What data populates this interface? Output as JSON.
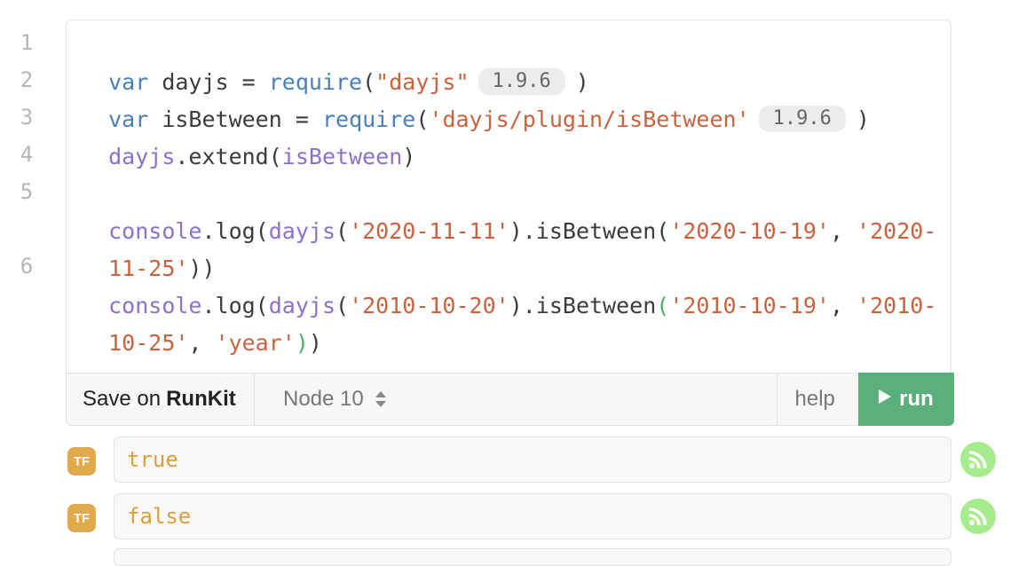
{
  "editor": {
    "line_numbers": [
      "1",
      "2",
      "3",
      "4",
      "5",
      "6"
    ],
    "lines": [
      {
        "kw": "var",
        "name": " dayjs ",
        "eq": "=",
        "fn": "require",
        "open": "(",
        "str": "\"dayjs\"",
        "version": "1.9.6",
        "close": ")"
      },
      {
        "kw": "var",
        "name": " isBetween ",
        "eq": "=",
        "fn": "require",
        "open": "(",
        "str": "'dayjs/plugin/isBetween'",
        "version": "1.9.6",
        "close": ")"
      },
      {
        "obj": "dayjs",
        "method": ".extend(",
        "arg": "isBetween",
        "close": ")"
      },
      {
        "obj": "console",
        "method": ".log(",
        "fn": "dayjs",
        "open": "(",
        "str1": "'2020-11-11'",
        "mid": ").isBetween(",
        "str2": "'2020-10-19'",
        "comma": ", ",
        "str3a": "'2020-",
        "str3b": "11-25'",
        "close": "))"
      },
      {
        "obj": "console",
        "method": ".log(",
        "fn": "dayjs",
        "open": "(",
        "str1": "'2010-10-20'",
        "mid": ").isBetween",
        "paren": "(",
        "str2": "'2010-10-19'",
        "comma": ", ",
        "str3a": "'2010-",
        "str3b": "10-25'",
        "comma2": ", ",
        "str4": "'year'",
        "close1": ")",
        "close2": ")"
      }
    ]
  },
  "toolbar": {
    "save_label": "Save on",
    "save_brand": "RunKit",
    "node_label": "Node 10",
    "help_label": "help",
    "run_label": "run"
  },
  "results": [
    {
      "badge": "TF",
      "value": "true"
    },
    {
      "badge": "TF",
      "value": "false"
    }
  ],
  "colors": {
    "keyword": "#4a7fb8",
    "function": "#8a72c9",
    "string": "#c9623e",
    "run_button": "#5aaf7a",
    "badge": "#e2a94a",
    "result_text": "#d89f3c",
    "rss_icon_bg": "#a6ec8c"
  },
  "icons": {
    "run": "play-icon",
    "node_select": "sort-arrows-icon",
    "result_action": "rss-icon"
  }
}
